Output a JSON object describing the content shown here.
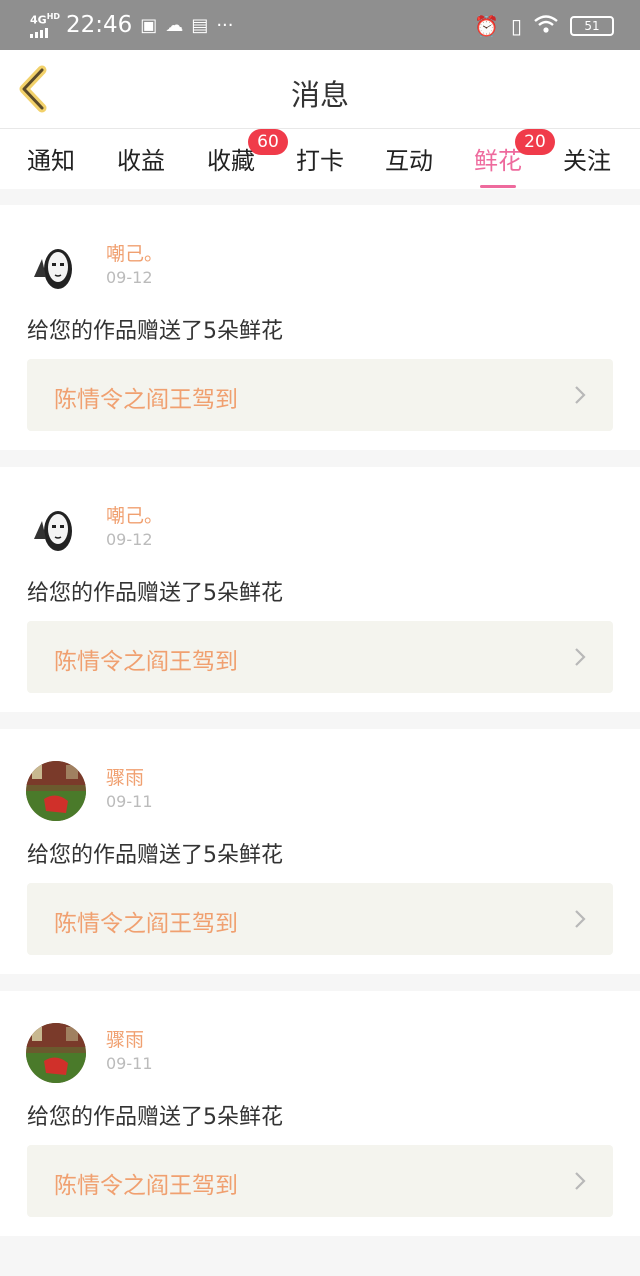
{
  "status_bar": {
    "network": "4G",
    "network_sub": "HD",
    "time": "22:46",
    "icons": [
      "app-icon-1",
      "cloud-icon",
      "app-icon-2",
      "more-dots-icon"
    ],
    "right_icons": [
      "alarm-icon",
      "vibrate-icon",
      "wifi-icon"
    ],
    "battery": "51"
  },
  "header": {
    "title": "消息",
    "back_icon": "chevron-left-icon"
  },
  "tabs": [
    {
      "label": "通知",
      "badge": "",
      "active": false
    },
    {
      "label": "收益",
      "badge": "",
      "active": false
    },
    {
      "label": "收藏",
      "badge": "60",
      "active": false
    },
    {
      "label": "打卡",
      "badge": "",
      "active": false
    },
    {
      "label": "互动",
      "badge": "",
      "active": false
    },
    {
      "label": "鲜花",
      "badge": "20",
      "active": true
    },
    {
      "label": "关注",
      "badge": "",
      "active": false
    }
  ],
  "messages": [
    {
      "user": "嘲己。",
      "date": "09-12",
      "text": "给您的作品赠送了5朵鲜花",
      "work": "陈情令之阎王驾到",
      "avatar": "mask-avatar"
    },
    {
      "user": "嘲己。",
      "date": "09-12",
      "text": "给您的作品赠送了5朵鲜花",
      "work": "陈情令之阎王驾到",
      "avatar": "mask-avatar"
    },
    {
      "user": "骤雨",
      "date": "09-11",
      "text": "给您的作品赠送了5朵鲜花",
      "work": "陈情令之阎王驾到",
      "avatar": "photo-avatar"
    },
    {
      "user": "骤雨",
      "date": "09-11",
      "text": "给您的作品赠送了5朵鲜花",
      "work": "陈情令之阎王驾到",
      "avatar": "photo-avatar"
    }
  ],
  "colors": {
    "accent": "#ee6a9d",
    "badge": "#f03b4a",
    "username": "#f0a070",
    "work_bg": "#f4f4ee",
    "status_bar": "#8f8f8f"
  }
}
